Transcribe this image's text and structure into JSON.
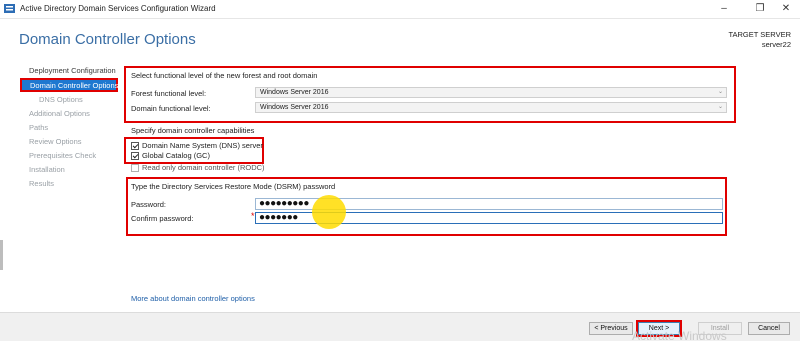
{
  "window": {
    "title": "Active Directory Domain Services Configuration Wizard",
    "controls": {
      "minimize": "–",
      "restore": "❐",
      "close": "✕"
    }
  },
  "header": {
    "page_title": "Domain Controller Options",
    "target_server_label": "TARGET SERVER",
    "target_server_name": "server22"
  },
  "sidebar": {
    "items": [
      {
        "label": "Deployment Configuration",
        "state": "enabled"
      },
      {
        "label": "Domain Controller Options",
        "state": "selected"
      },
      {
        "label": "DNS Options",
        "state": "disabled"
      },
      {
        "label": "Additional Options",
        "state": "disabled"
      },
      {
        "label": "Paths",
        "state": "disabled"
      },
      {
        "label": "Review Options",
        "state": "disabled"
      },
      {
        "label": "Prerequisites Check",
        "state": "disabled"
      },
      {
        "label": "Installation",
        "state": "disabled"
      },
      {
        "label": "Results",
        "state": "disabled"
      }
    ]
  },
  "functional_level": {
    "heading": "Select functional level of the new forest and root domain",
    "forest_label": "Forest functional level:",
    "forest_value": "Windows Server 2016",
    "domain_label": "Domain functional level:",
    "domain_value": "Windows Server 2016"
  },
  "capabilities": {
    "heading": "Specify domain controller capabilities",
    "dns_label": "Domain Name System (DNS) server",
    "dns_checked": true,
    "gc_label": "Global Catalog (GC)",
    "gc_checked": true,
    "rodc_label": "Read only domain controller (RODC)",
    "rodc_checked": false
  },
  "dsrm": {
    "heading": "Type the Directory Services Restore Mode (DSRM) password",
    "password_label": "Password:",
    "password_value": "●●●●●●●●●",
    "confirm_label": "Confirm password:",
    "confirm_value": "●●●●●●●",
    "required_marker": "*"
  },
  "more_link": "More about domain controller options",
  "footer": {
    "previous": "< Previous",
    "next": "Next >",
    "install": "Install",
    "cancel": "Cancel"
  },
  "watermark": "Activate Windows",
  "colors": {
    "accent": "#1e78d0",
    "annotation_red": "#e00000",
    "title_blue": "#3a6ea5"
  }
}
